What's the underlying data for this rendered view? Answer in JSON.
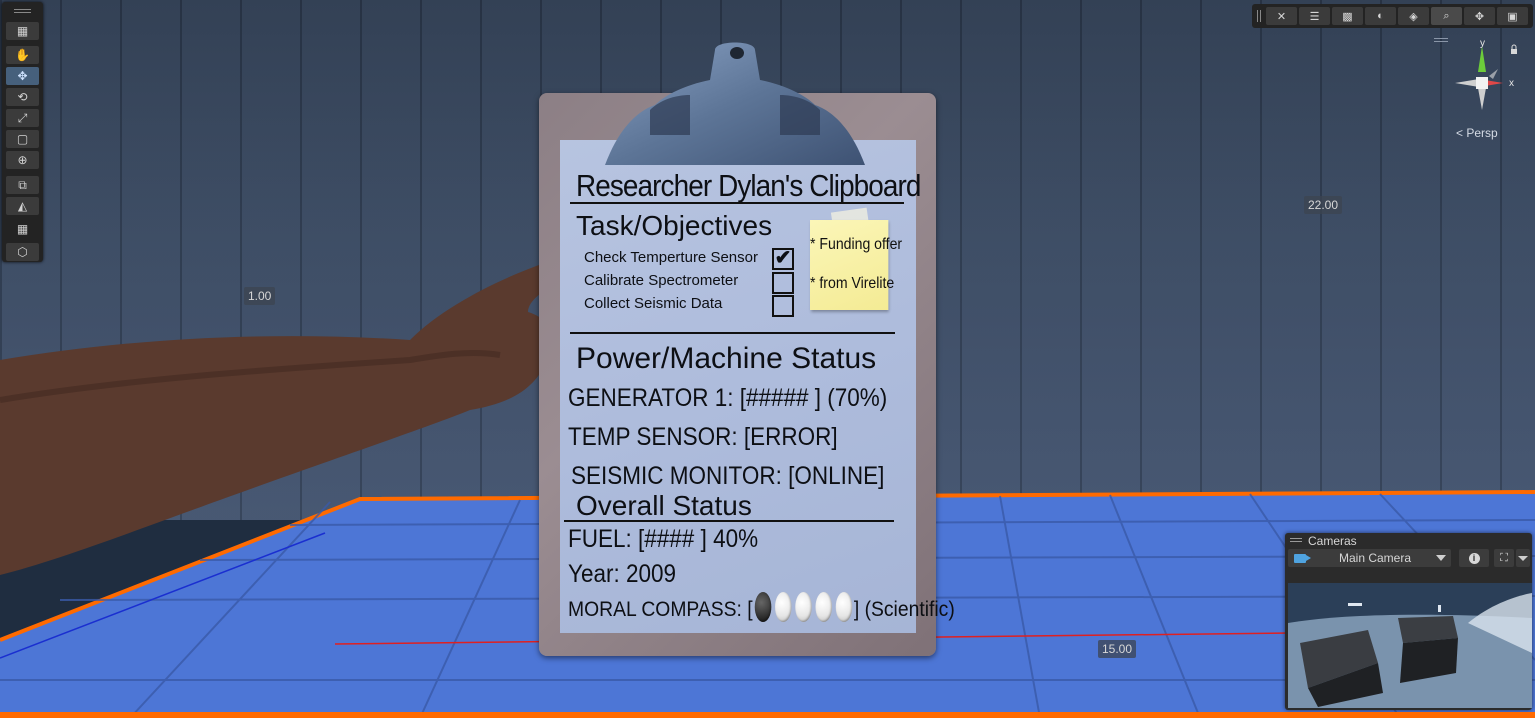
{
  "clipboard": {
    "title": "Researcher Dylan's Clipboard",
    "tasks_heading": "Task/Objectives",
    "tasks": [
      {
        "label": "Check Temperture Sensor",
        "checked": true
      },
      {
        "label": "Calibrate Spectrometer",
        "checked": false
      },
      {
        "label": "Collect Seismic Data",
        "checked": false
      }
    ],
    "check_mark": "✔",
    "power_heading": "Power/Machine Status",
    "generator": "GENERATOR 1: [#####     ] (70%)",
    "temp_sensor": "TEMP SENSOR: [ERROR]",
    "seismic": "SEISMIC MONITOR: [ONLINE]",
    "overall_heading": "Overall Status",
    "fuel": "FUEL: [####      ]  40%",
    "year": "Year: 2009",
    "moral_label": "MORAL COMPASS: [",
    "moral_close": "] (Scientific)",
    "moral_filled": 1,
    "moral_total": 5
  },
  "sticky_note": {
    "line1": "*  Funding offer",
    "line2": "*  from Virelite"
  },
  "grid_labels": {
    "left": "1.00",
    "right": "22.00",
    "bottom": "15.00"
  },
  "gizmo": {
    "y_label": "y",
    "x_label": "x",
    "persp_label": "< Persp"
  },
  "cameras_panel": {
    "title": "Cameras",
    "selected_camera": "Main Camera"
  },
  "tools": [
    "grid-icon",
    "hand-icon",
    "move-icon",
    "rotate-icon",
    "scale-icon",
    "rect-icon",
    "transform-icon",
    "custom-tool-icon",
    "terrain-icon",
    "grid-snap-icon",
    "cube-icon"
  ],
  "top_toolbar": [
    "wrench-icon",
    "layout-icon",
    "wireframe-icon",
    "shading-icon",
    "layers-icon",
    "search-icon",
    "move-snap-icon",
    "camera-icon"
  ],
  "colors": {
    "accent_orange": "#ff6a00",
    "floor_blue": "#4d76d6",
    "paper": "#aebcdc",
    "sticky": "#f6ee9e"
  }
}
